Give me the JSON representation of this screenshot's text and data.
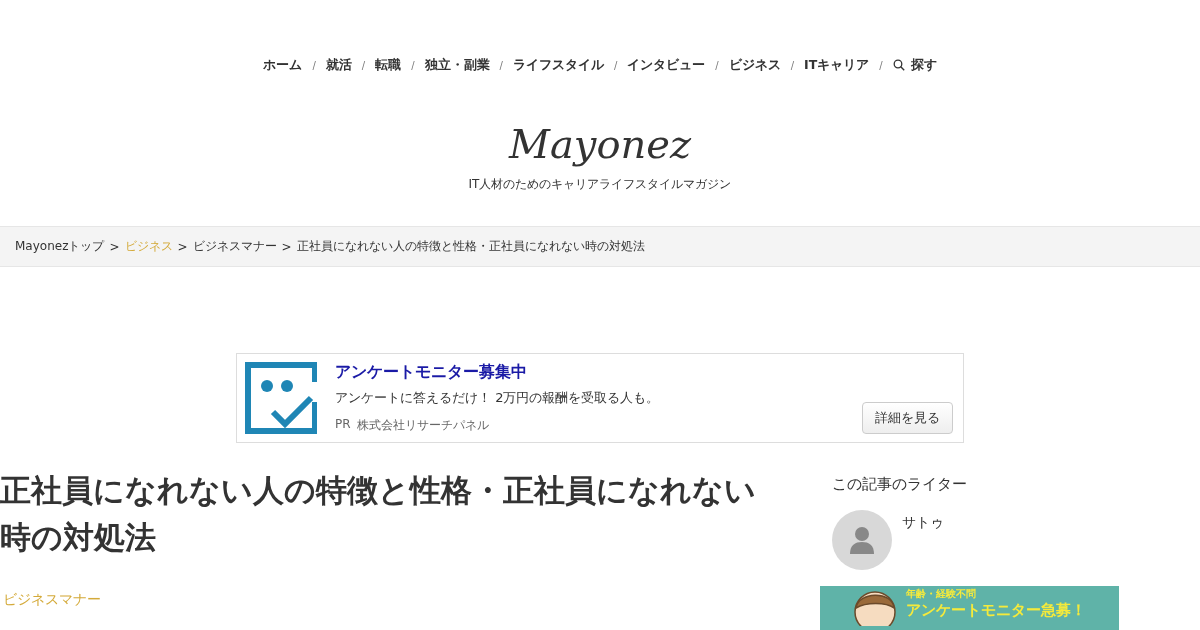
{
  "nav": [
    {
      "kind": "link",
      "label": "ホーム"
    },
    {
      "kind": "sep",
      "label": "/"
    },
    {
      "kind": "link",
      "label": "就活"
    },
    {
      "kind": "sep",
      "label": "/"
    },
    {
      "kind": "link",
      "label": "転職"
    },
    {
      "kind": "sep",
      "label": "/"
    },
    {
      "kind": "link",
      "label": "独立・副業"
    },
    {
      "kind": "sep",
      "label": "/"
    },
    {
      "kind": "link",
      "label": "ライフスタイル"
    },
    {
      "kind": "sep",
      "label": "/"
    },
    {
      "kind": "link",
      "label": "インタビュー"
    },
    {
      "kind": "sep",
      "label": "/"
    },
    {
      "kind": "link",
      "label": "ビジネス"
    },
    {
      "kind": "sep",
      "label": "/"
    },
    {
      "kind": "link",
      "label": "ITキャリア"
    },
    {
      "kind": "sep",
      "label": "/"
    },
    {
      "kind": "search",
      "label": "探す"
    }
  ],
  "logo": "Mayonez",
  "tagline": "IT人材のためのキャリアライフスタイルマガジン",
  "breadcrumb": [
    {
      "kind": "link",
      "label": "Mayonezトップ"
    },
    {
      "kind": "sep",
      "label": ">"
    },
    {
      "kind": "category",
      "label": "ビジネス"
    },
    {
      "kind": "sep",
      "label": ">"
    },
    {
      "kind": "link",
      "label": "ビジネスマナー"
    },
    {
      "kind": "sep",
      "label": ">"
    },
    {
      "kind": "current",
      "label": "正社員になれない人の特徴と性格・正社員になれない時の対処法"
    }
  ],
  "ad": {
    "title": "アンケートモニター募集中",
    "text": "アンケートに答えるだけ！ 2万円の報酬を受取る人も。",
    "pr": "PR",
    "sponsor": "株式会社リサーチパネル",
    "button": "詳細を見る"
  },
  "article": {
    "title": "正社員になれない人の特徴と性格・正社員になれない時の対処法",
    "category": "ビジネスマナー"
  },
  "sidebar": {
    "heading": "この記事のライター",
    "writer": "サトゥ",
    "banner": {
      "subtitle": "年齢・経験不問",
      "title": "アンケートモニター急募！"
    }
  }
}
